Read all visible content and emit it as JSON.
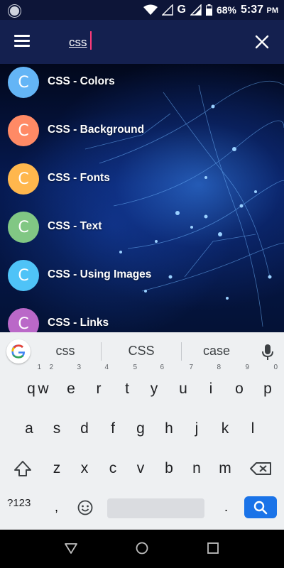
{
  "status_bar": {
    "network": "G",
    "battery": "68%",
    "time": "5:37",
    "time_suffix": "PM"
  },
  "app_bar": {
    "search_value": "css",
    "icons": {
      "menu": "hamburger-menu-icon",
      "close": "close-icon"
    }
  },
  "results": [
    {
      "initial": "C",
      "label": "CSS - Colors",
      "color": "#64b5f6"
    },
    {
      "initial": "C",
      "label": "CSS - Background",
      "color": "#ff8a65"
    },
    {
      "initial": "C",
      "label": "CSS - Fonts",
      "color": "#ffb74d"
    },
    {
      "initial": "C",
      "label": "CSS - Text",
      "color": "#81c784"
    },
    {
      "initial": "C",
      "label": "CSS - Using Images",
      "color": "#4fc3f7"
    },
    {
      "initial": "C",
      "label": "CSS - Links",
      "color": "#ba68c8"
    }
  ],
  "keyboard": {
    "suggestions": [
      "css",
      "CSS",
      "case"
    ],
    "row1": [
      {
        "k": "q",
        "n": "1"
      },
      {
        "k": "w",
        "n": "2"
      },
      {
        "k": "e",
        "n": "3"
      },
      {
        "k": "r",
        "n": "4"
      },
      {
        "k": "t",
        "n": "5"
      },
      {
        "k": "y",
        "n": "6"
      },
      {
        "k": "u",
        "n": "7"
      },
      {
        "k": "i",
        "n": "8"
      },
      {
        "k": "o",
        "n": "9"
      },
      {
        "k": "p",
        "n": "0"
      }
    ],
    "row2": [
      "a",
      "s",
      "d",
      "f",
      "g",
      "h",
      "j",
      "k",
      "l"
    ],
    "row3": [
      "z",
      "x",
      "c",
      "v",
      "b",
      "n",
      "m"
    ],
    "symbols_label": "?123",
    "comma": ",",
    "period": ".",
    "accent_color": "#1a73e8"
  },
  "nav_bar": {
    "icons": [
      "back-triangle-icon",
      "home-circle-icon",
      "recents-square-icon"
    ]
  }
}
